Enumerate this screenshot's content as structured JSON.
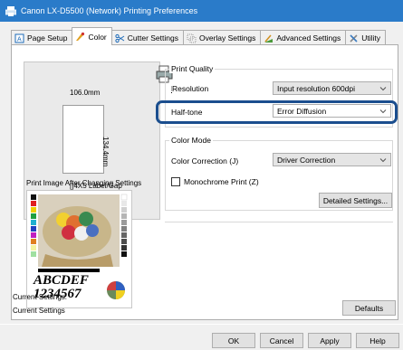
{
  "window": {
    "title": "Canon LX-D5500 (Network) Printing Preferences"
  },
  "tabs": [
    {
      "label": "Page Setup",
      "icon": "page-setup-icon"
    },
    {
      "label": "Color",
      "icon": "color-icon"
    },
    {
      "label": "Cutter Settings",
      "icon": "scissors-icon"
    },
    {
      "label": "Overlay Settings",
      "icon": "overlay-icon"
    },
    {
      "label": "Advanced Settings",
      "icon": "advanced-icon"
    },
    {
      "label": "Utility",
      "icon": "utility-icon"
    }
  ],
  "preview": {
    "width_label": "106.0mm",
    "height_label": "134.4mm",
    "paper_label": "[]4X5 Label/Gap",
    "print_image_label": "Print Image After Changing Settings",
    "sample_text_1": "ABCDEF",
    "sample_text_2": "1234567"
  },
  "print_quality": {
    "title": "Print Quality",
    "resolution_label": "Resolution",
    "resolution_value": "Input resolution 600dpi",
    "halftone_label": "Half-tone",
    "halftone_value": "Error Diffusion"
  },
  "color_mode": {
    "title": "Color Mode",
    "correction_label": "Color Correction (J)",
    "correction_value": "Driver Correction",
    "monochrome_label": "Monochrome Print (Z)",
    "detailed_button": "Detailed Settings..."
  },
  "status": {
    "line1": "Current Settings:",
    "line2": "Current Settings",
    "defaults_button": "Defaults"
  },
  "footer": {
    "ok": "OK",
    "cancel": "Cancel",
    "apply": "Apply",
    "help": "Help"
  },
  "colors": {
    "titlebar": "#2a7bc9",
    "highlight": "#1b4e8e"
  }
}
